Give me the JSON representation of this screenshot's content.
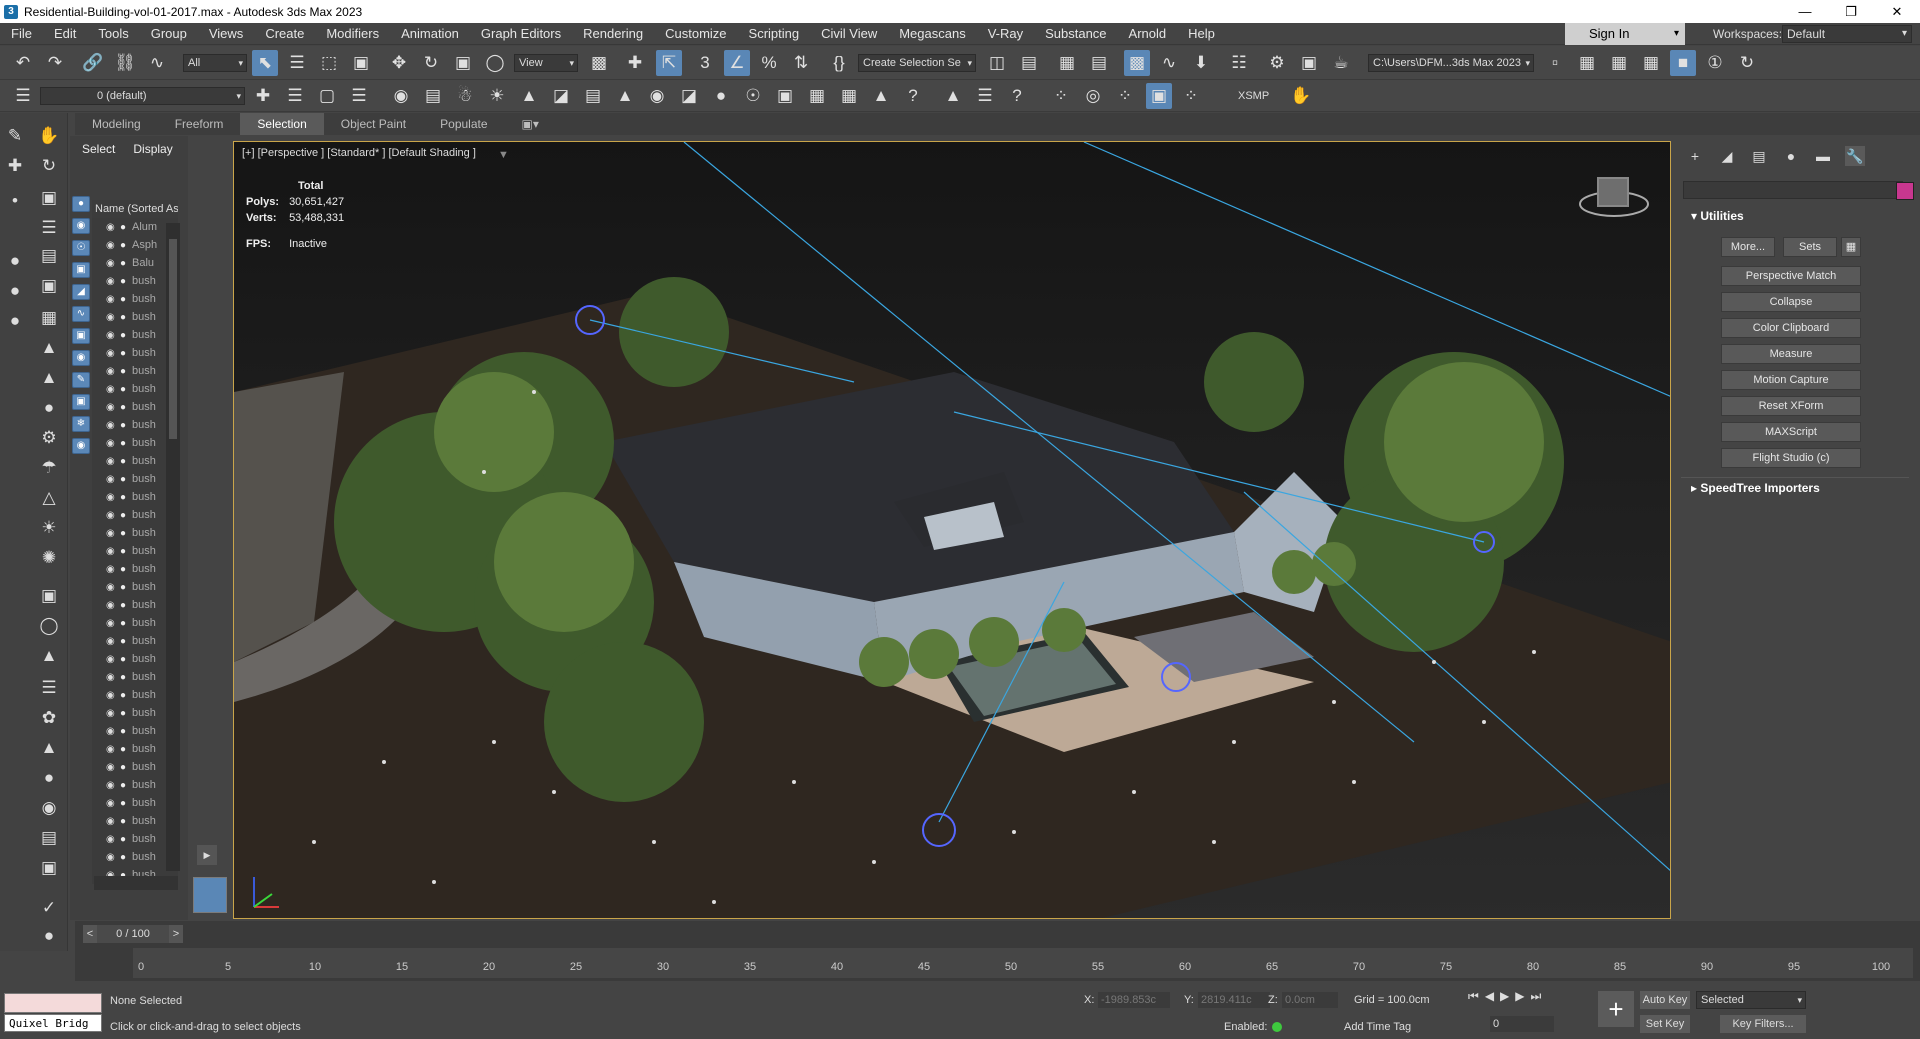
{
  "window": {
    "title": "Residential-Building-vol-01-2017.max - Autodesk 3ds Max 2023"
  },
  "menu": [
    "File",
    "Edit",
    "Tools",
    "Group",
    "Views",
    "Create",
    "Modifiers",
    "Animation",
    "Graph Editors",
    "Rendering",
    "Customize",
    "Scripting",
    "Civil View",
    "Megascans",
    "V-Ray",
    "Substance",
    "Arnold",
    "Help"
  ],
  "signin": "Sign In",
  "workspace": {
    "label": "Workspaces:",
    "value": "Default"
  },
  "toolbar": {
    "filter": "All",
    "ref_coord": "View",
    "selection_set": "Create Selection Se",
    "project_path": "C:\\Users\\DFM...3ds Max 2023",
    "layer": "0 (default)",
    "xsmp": "XSMP"
  },
  "ribbon_tabs": [
    "Modeling",
    "Freeform",
    "Selection",
    "Object Paint",
    "Populate"
  ],
  "explorer": {
    "tabs": [
      "Select",
      "Display"
    ],
    "column": "Name (Sorted Asce",
    "rows": [
      "Alum",
      "Asph",
      "Balu",
      "bush",
      "bush",
      "bush",
      "bush",
      "bush",
      "bush",
      "bush",
      "bush",
      "bush",
      "bush",
      "bush",
      "bush",
      "bush",
      "bush",
      "bush",
      "bush",
      "bush",
      "bush",
      "bush",
      "bush",
      "bush",
      "bush",
      "bush",
      "bush",
      "bush",
      "bush",
      "bush",
      "bush",
      "bush",
      "bush",
      "bush",
      "bush",
      "bush",
      "bush"
    ]
  },
  "viewport": {
    "label": "[+] [Perspective ] [Standard* ] [Default Shading ]",
    "stats_title": "Total",
    "polys_label": "Polys:",
    "polys": "30,651,427",
    "verts_label": "Verts:",
    "verts": "53,488,331",
    "fps_label": "FPS:",
    "fps": "Inactive"
  },
  "command_panel": {
    "utilities_title": "Utilities",
    "more": "More...",
    "sets": "Sets",
    "buttons": [
      "Perspective Match",
      "Collapse",
      "Color Clipboard",
      "Measure",
      "Motion Capture",
      "Reset XForm",
      "MAXScript",
      "Flight Studio (c)"
    ],
    "speedtree": "SpeedTree Importers"
  },
  "timeline": {
    "position": "0 / 100",
    "ticks": [
      "0",
      "5",
      "10",
      "15",
      "20",
      "25",
      "30",
      "35",
      "40",
      "45",
      "50",
      "55",
      "60",
      "65",
      "70",
      "75",
      "80",
      "85",
      "90",
      "95",
      "100"
    ]
  },
  "status": {
    "selection": "None Selected",
    "prompt": "Click or click-and-drag to select objects",
    "quixel": "Quixel Bridg",
    "x_label": "X:",
    "x": "-1989.853c",
    "y_label": "Y:",
    "y": "2819.411c",
    "z_label": "Z:",
    "z": "0.0cm",
    "grid": "Grid = 100.0cm",
    "enabled": "Enabled:",
    "add_time_tag": "Add Time Tag",
    "auto_key": "Auto Key",
    "set_key": "Set Key",
    "selected": "Selected",
    "key_filters": "Key Filters...",
    "frame": "0"
  },
  "colors": {
    "accent": "#5a87b6",
    "viewport_border": "#c9a54a",
    "swatch": "#c8378f"
  }
}
